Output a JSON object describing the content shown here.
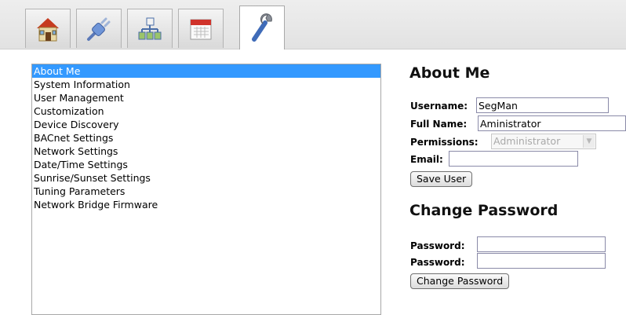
{
  "toolbar": {
    "tabs": [
      {
        "icon": "home-icon",
        "active": false
      },
      {
        "icon": "plug-icon",
        "active": false
      },
      {
        "icon": "network-icon",
        "active": false
      },
      {
        "icon": "calendar-icon",
        "active": false
      },
      {
        "icon": "wrench-icon",
        "active": true
      }
    ]
  },
  "menu": {
    "items": [
      "About Me",
      "System Information",
      "User Management",
      "Customization",
      "Device Discovery",
      "BACnet Settings",
      "Network Settings",
      "Date/Time Settings",
      "Sunrise/Sunset Settings",
      "Tuning Parameters",
      "Network Bridge Firmware"
    ],
    "selected_index": 0
  },
  "about": {
    "title": "About Me",
    "username_label": "Username:",
    "username_value": "SegMan",
    "fullname_label": "Full Name:",
    "fullname_value": "Aministrator",
    "permissions_label": "Permissions:",
    "permissions_value": "Administrator",
    "email_label": "Email:",
    "email_value": "",
    "save_label": "Save User"
  },
  "password": {
    "title": "Change Password",
    "password_label": "Password:",
    "confirm_label": "Password:",
    "password_value": "",
    "confirm_value": "",
    "change_label": "Change Password"
  },
  "colors": {
    "selection": "#3399ff",
    "toolbar_bg": "#e6e6e6"
  }
}
